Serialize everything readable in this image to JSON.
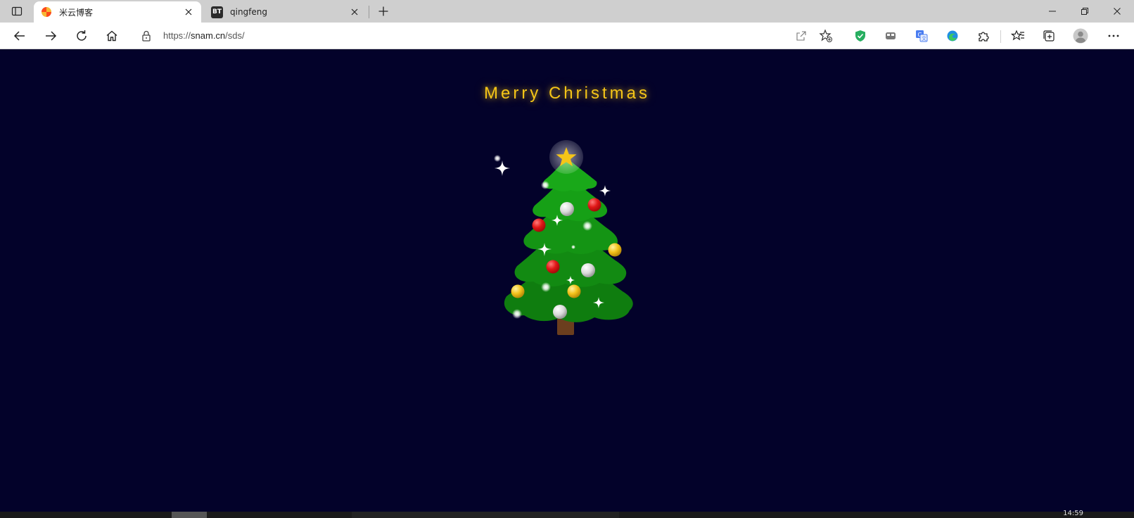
{
  "browser": {
    "tabs": [
      {
        "title": "米云博客",
        "favicon": "blog-favicon",
        "active": true
      },
      {
        "title": "qingfeng",
        "favicon": "bt-favicon",
        "favicon_text": "BT",
        "active": false
      }
    ],
    "address": {
      "scheme": "https://",
      "host": "snam.cn",
      "path": "/sds/"
    }
  },
  "page": {
    "heading": "Merry Christmas"
  },
  "taskbar": {
    "clock": "14:59"
  },
  "colors": {
    "background": "#03022a",
    "heading": "#f5c518",
    "tree": "#128a12",
    "trunk": "#6b3e1e",
    "ornament_red": "#e01717",
    "ornament_gold": "#f2c21b",
    "ornament_silver": "#d9d9d9"
  }
}
